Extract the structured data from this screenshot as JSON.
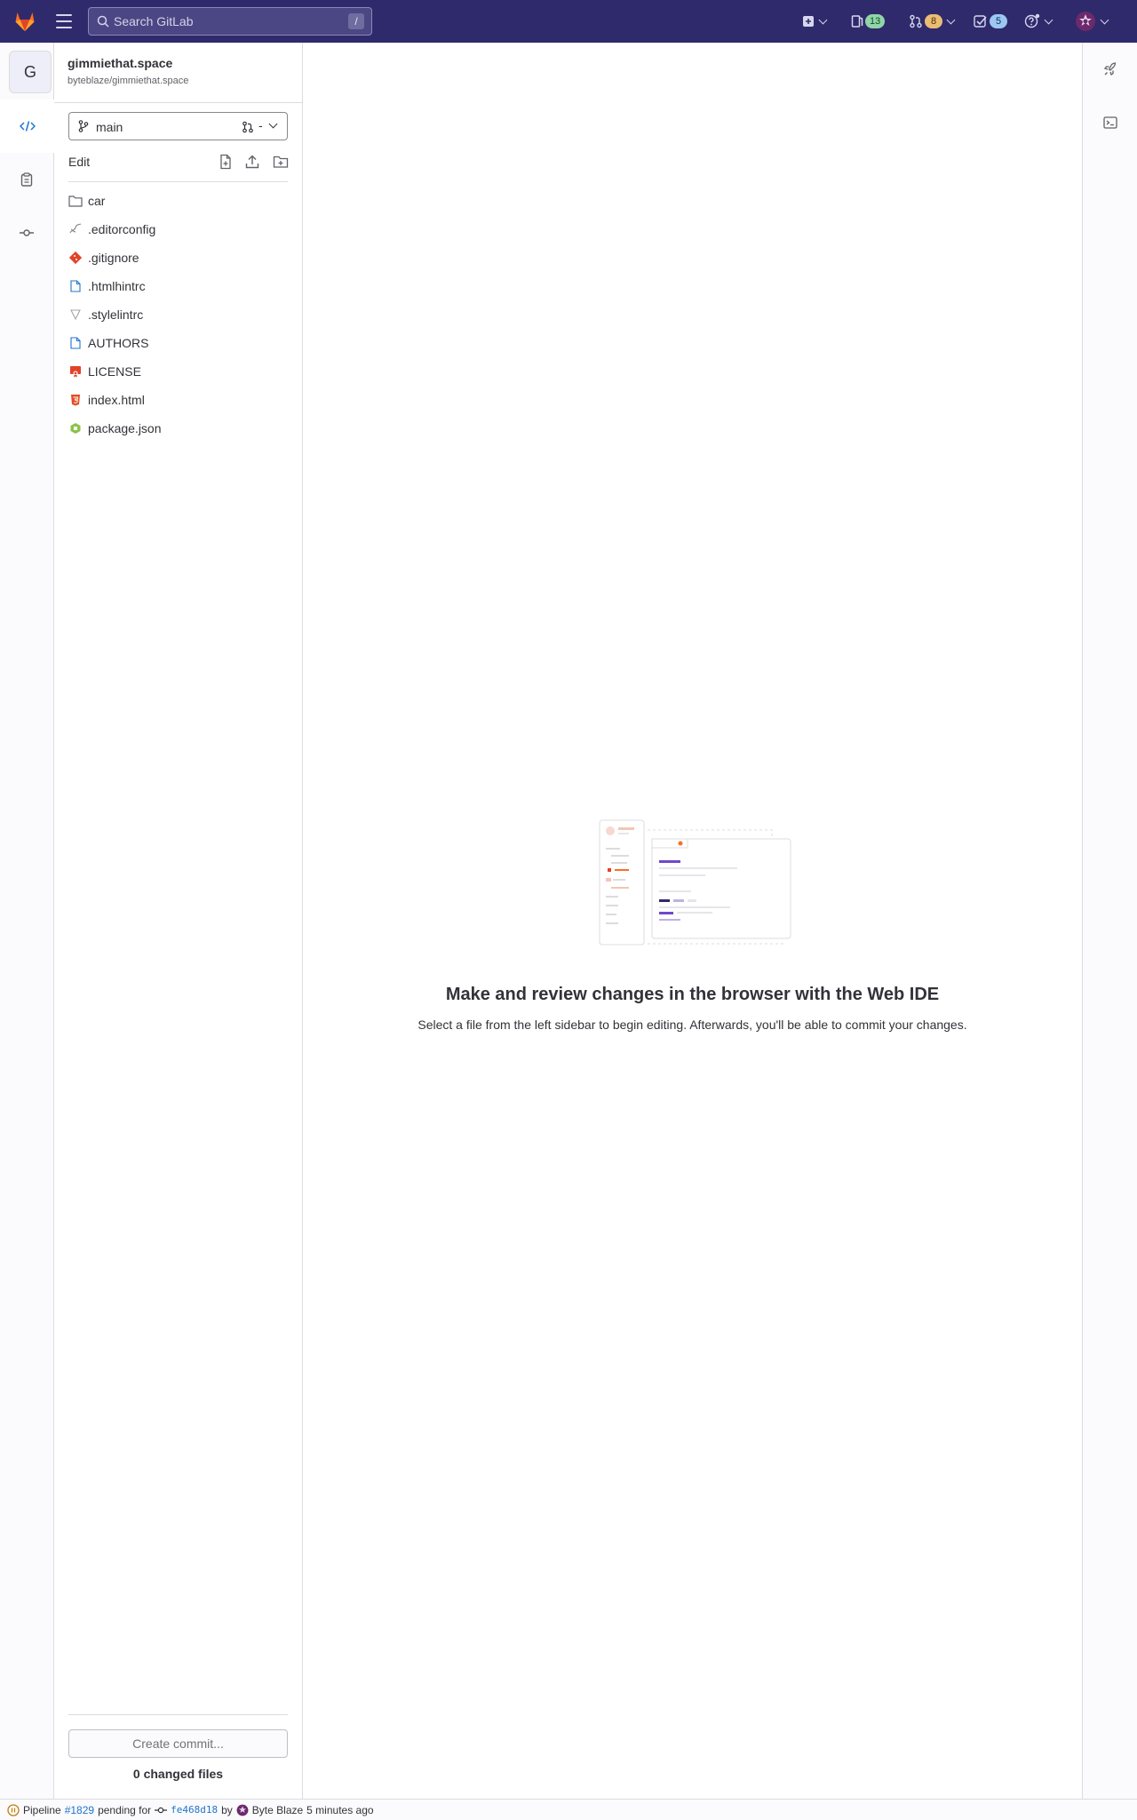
{
  "topbar": {
    "search_placeholder": "Search GitLab",
    "search_shortcut": "/",
    "issues_count": "13",
    "merge_requests_count": "8",
    "todos_count": "5",
    "colors": {
      "background": "#2f2a6b"
    }
  },
  "project": {
    "avatar_letter": "G",
    "name": "gimmiethat.space",
    "path": "byteblaze/gimmiethat.space"
  },
  "branch": {
    "name": "main",
    "mr_placeholder": "-"
  },
  "file_panel": {
    "edit_label": "Edit",
    "files": [
      {
        "name": "car",
        "icon": "folder-icon"
      },
      {
        "name": ".editorconfig",
        "icon": "editorconfig-icon"
      },
      {
        "name": ".gitignore",
        "icon": "git-icon"
      },
      {
        "name": ".htmlhintrc",
        "icon": "file-icon"
      },
      {
        "name": ".stylelintrc",
        "icon": "stylelint-icon"
      },
      {
        "name": "AUTHORS",
        "icon": "file-icon"
      },
      {
        "name": "LICENSE",
        "icon": "license-icon"
      },
      {
        "name": "index.html",
        "icon": "html-icon"
      },
      {
        "name": "package.json",
        "icon": "npm-icon"
      }
    ],
    "commit_button": "Create commit...",
    "changed_files": "0 changed files"
  },
  "main": {
    "empty_title": "Make and review changes in the browser with the Web IDE",
    "empty_description": "Select a file from the left sidebar to begin editing. Afterwards, you'll be able to commit your changes."
  },
  "statusbar": {
    "prefix": "Pipeline",
    "pipeline_id": "#1829",
    "status_text": "pending for",
    "commit_sha": "fe468d18",
    "by": "by",
    "author": "Byte Blaze",
    "time": "5 minutes ago"
  }
}
